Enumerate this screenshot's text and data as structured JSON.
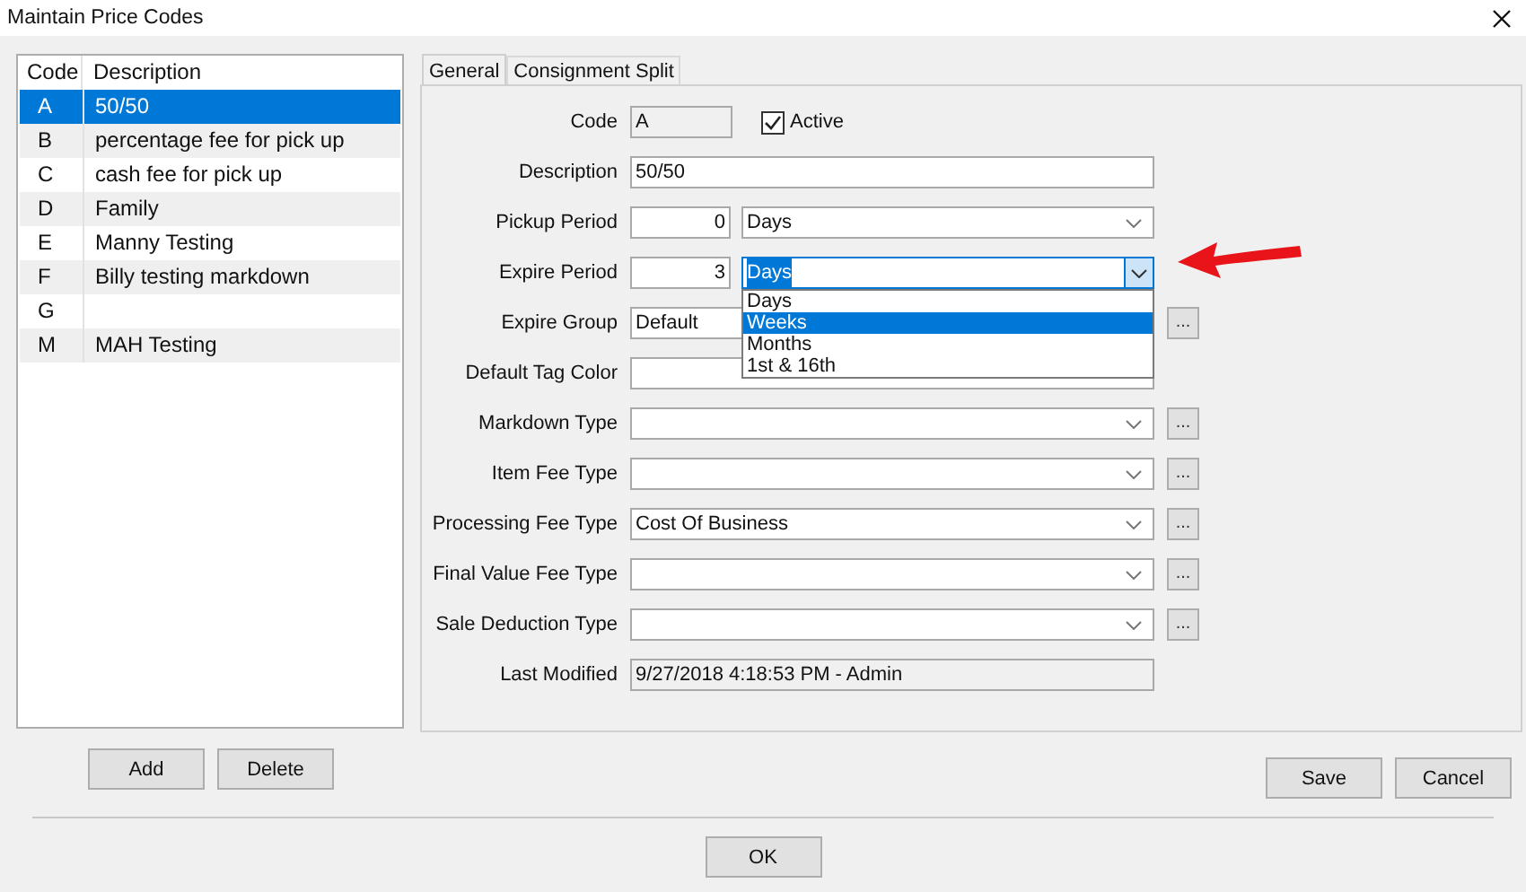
{
  "window": {
    "title": "Maintain Price Codes"
  },
  "list": {
    "columns": [
      "Code",
      "Description"
    ],
    "rows": [
      {
        "code": "A",
        "description": "50/50",
        "selected": true
      },
      {
        "code": "B",
        "description": "percentage fee for pick up",
        "selected": false
      },
      {
        "code": "C",
        "description": "cash fee for pick up",
        "selected": false
      },
      {
        "code": "D",
        "description": "Family",
        "selected": false
      },
      {
        "code": "E",
        "description": "Manny Testing",
        "selected": false
      },
      {
        "code": "F",
        "description": "Billy testing markdown",
        "selected": false
      },
      {
        "code": "G",
        "selected": false
      },
      {
        "code": "M",
        "description": "MAH Testing",
        "selected": false
      }
    ]
  },
  "list_buttons": [
    "Add",
    "Delete"
  ],
  "tabs": [
    {
      "label": "General",
      "selected": true
    },
    {
      "label": "Consignment Split",
      "selected": false
    }
  ],
  "form": [
    {
      "kind": "code",
      "label": "Code",
      "value": "A",
      "checkbox": {
        "label": "Active",
        "checked": true
      }
    },
    {
      "kind": "text",
      "label": "Description",
      "value": "50/50",
      "browse": false
    },
    {
      "kind": "period",
      "label": "Pickup Period",
      "number": "0",
      "unit": "Days",
      "open": false
    },
    {
      "kind": "period",
      "label": "Expire Period",
      "number": "3",
      "unit": "Days",
      "open": true,
      "options": [
        {
          "label": "Days",
          "selected": false
        },
        {
          "label": "Weeks",
          "selected": true
        },
        {
          "label": "Months",
          "selected": false
        },
        {
          "label": "1st & 16th",
          "selected": false
        }
      ]
    },
    {
      "kind": "text",
      "label": "Expire Group",
      "value": "Default",
      "browse": true
    },
    {
      "kind": "text",
      "label": "Default Tag Color",
      "browse": false
    },
    {
      "kind": "combo",
      "label": "Markdown Type",
      "browse": true
    },
    {
      "kind": "combo",
      "label": "Item Fee Type",
      "browse": true
    },
    {
      "kind": "combo",
      "label": "Processing Fee Type",
      "value": "Cost Of Business",
      "browse": true
    },
    {
      "kind": "combo",
      "label": "Final Value Fee Type",
      "browse": true
    },
    {
      "kind": "combo",
      "label": "Sale Deduction Type",
      "browse": true
    },
    {
      "kind": "readonly",
      "label": "Last Modified",
      "value": "9/27/2018 4:18:53 PM - Admin"
    }
  ],
  "browse_button": "...",
  "dialog_buttons": [
    "Save",
    "Cancel"
  ],
  "ok_button": "OK"
}
